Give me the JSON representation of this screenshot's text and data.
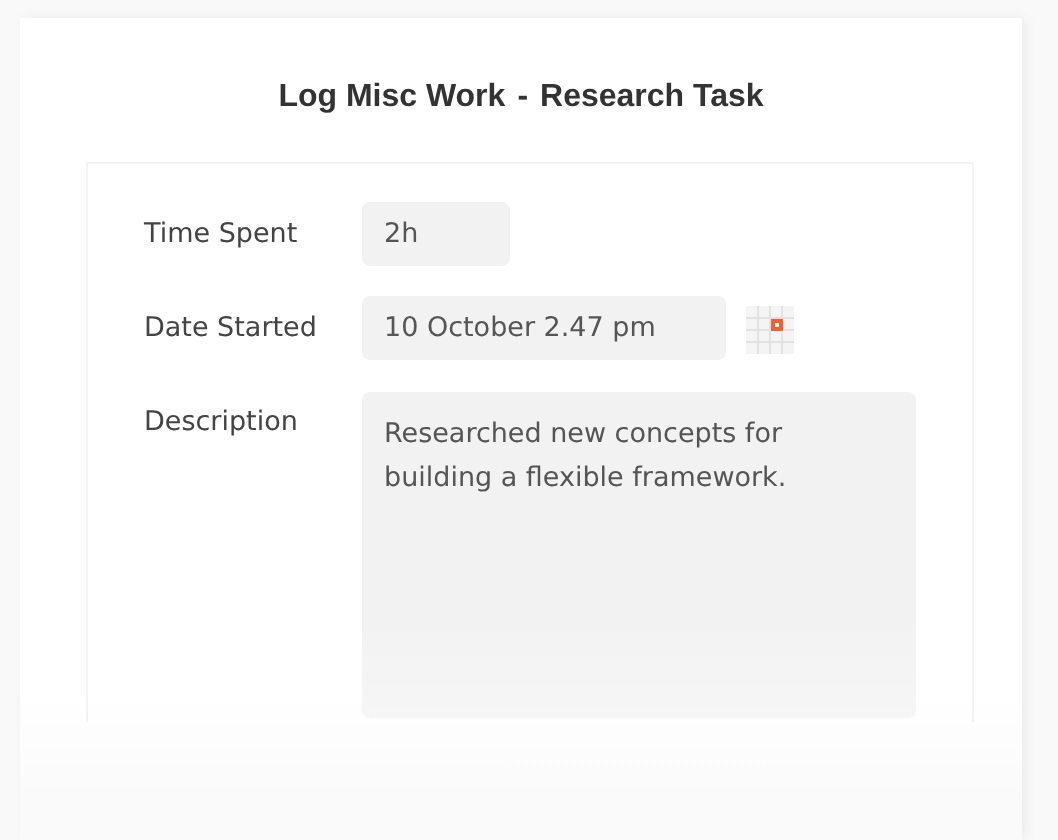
{
  "dialog": {
    "title": "Log Misc Work",
    "separator": "-",
    "subtitle": "Research Task"
  },
  "fields": [
    {
      "kind": "text",
      "label": "Time Spent",
      "value": "2h"
    },
    {
      "kind": "date",
      "label": "Date Started",
      "value": "10 October 2.47 pm"
    },
    {
      "kind": "textarea",
      "label": "Description",
      "value": "Researched new concepts for building a flexible framework."
    }
  ]
}
